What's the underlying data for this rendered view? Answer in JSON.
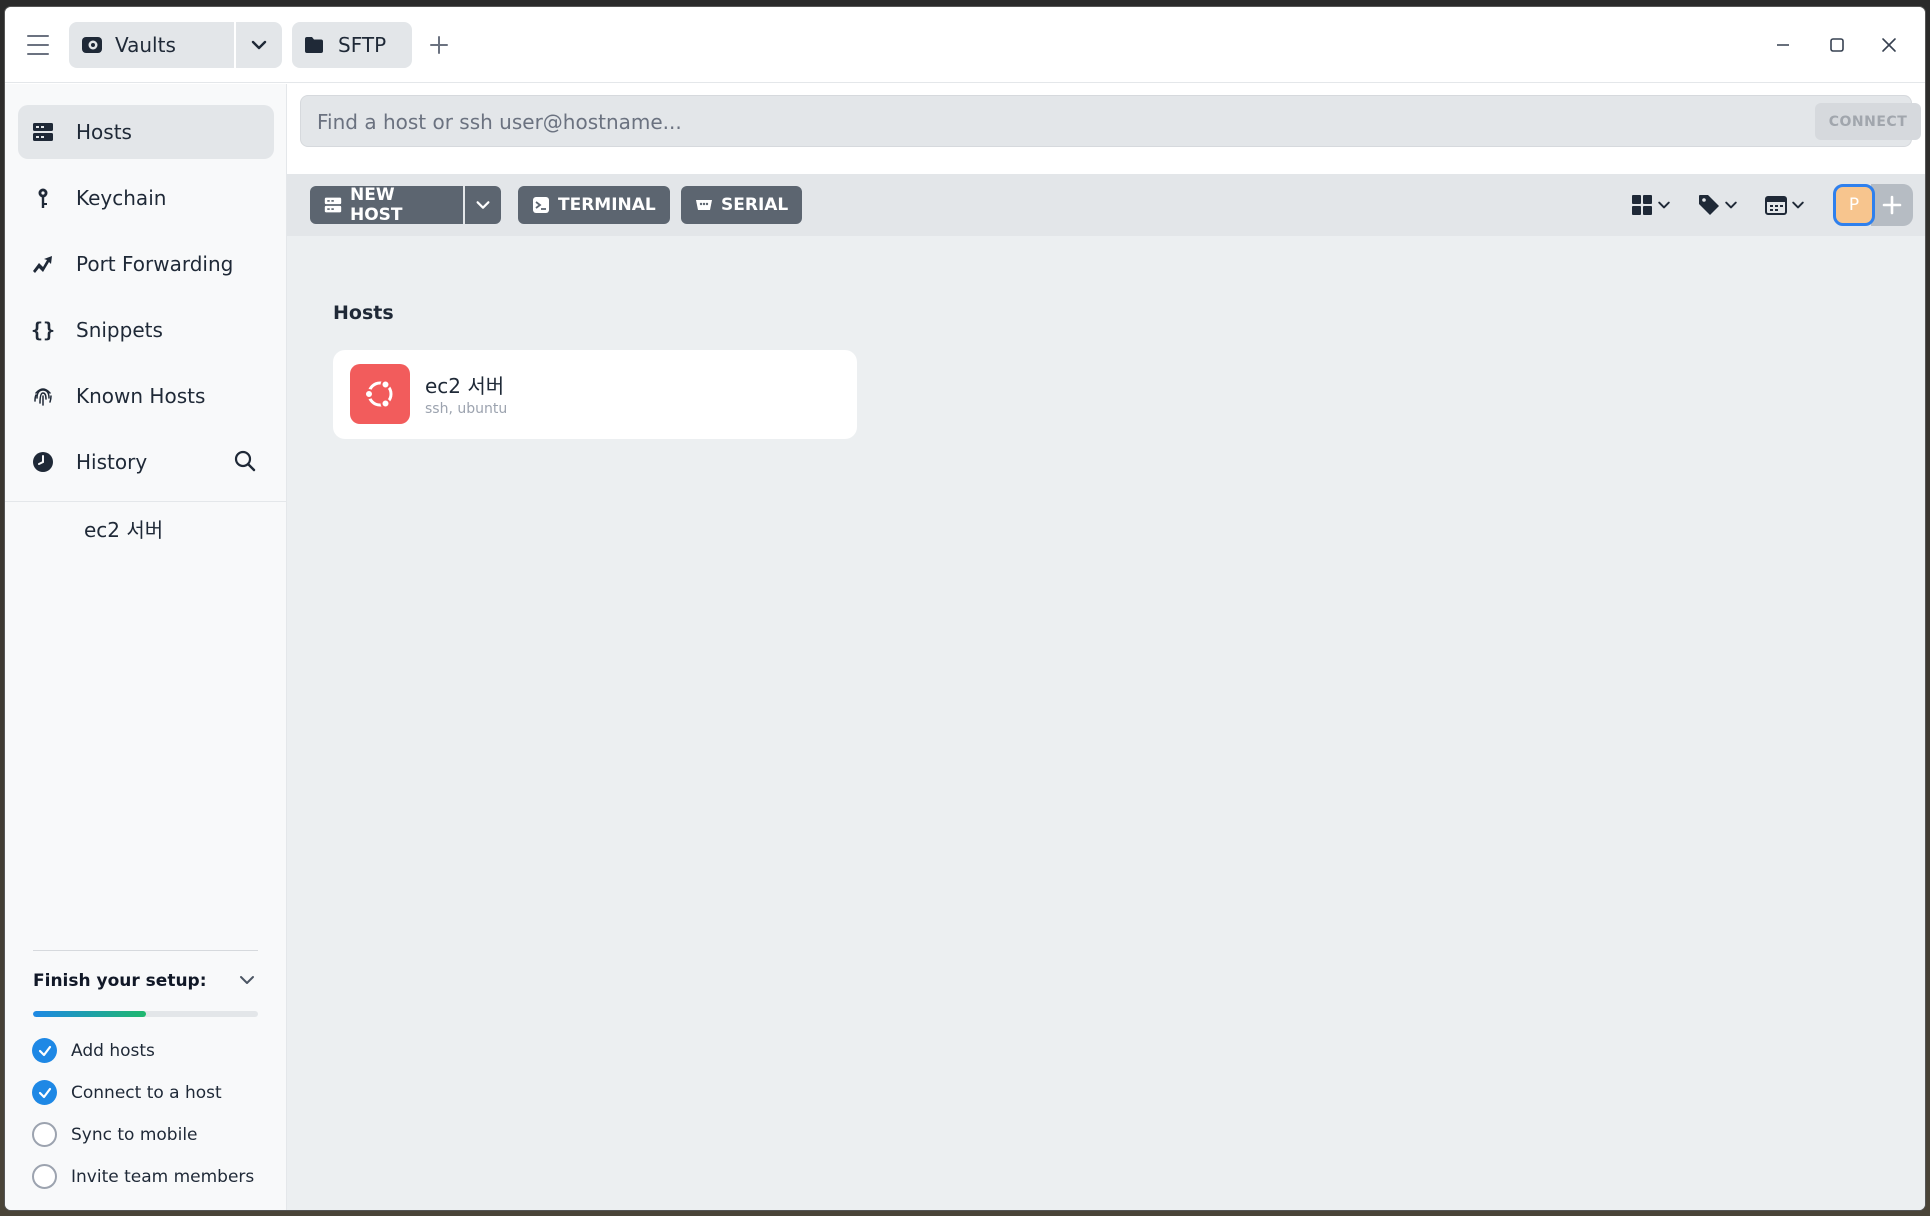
{
  "titlebar": {
    "vault_label": "Vaults",
    "sftp_label": "SFTP",
    "icons": [
      "menu-icon",
      "vault-icon",
      "chevron-down-icon",
      "folder-icon",
      "plus-icon",
      "minimize-icon",
      "maximize-icon",
      "close-icon"
    ]
  },
  "sidebar": {
    "items": [
      {
        "label": "Hosts",
        "icon": "server-icon",
        "active": true
      },
      {
        "label": "Keychain",
        "icon": "key-icon"
      },
      {
        "label": "Port Forwarding",
        "icon": "forward-icon"
      },
      {
        "label": "Snippets",
        "icon": "braces-icon"
      },
      {
        "label": "Known Hosts",
        "icon": "fingerprint-icon"
      },
      {
        "label": "History",
        "icon": "clock-icon"
      }
    ],
    "history_entries": [
      "ec2 서버"
    ],
    "setup": {
      "title": "Finish your setup:",
      "progress_fraction": 0.5,
      "tasks": [
        {
          "label": "Add hosts",
          "done": true
        },
        {
          "label": "Connect to a host",
          "done": true
        },
        {
          "label": "Sync to mobile",
          "done": false
        },
        {
          "label": "Invite team members",
          "done": false
        }
      ]
    }
  },
  "search": {
    "placeholder": "Find a host or ssh user@hostname...",
    "value": "",
    "connect_label": "CONNECT"
  },
  "toolbar": {
    "new_host_label": "NEW HOST",
    "terminal_label": "TERMINAL",
    "serial_label": "SERIAL",
    "avatar_initial": "P"
  },
  "main": {
    "section_title": "Hosts",
    "hosts": [
      {
        "name": "ec2 서버",
        "subtitle": "ssh, ubuntu",
        "os": "ubuntu"
      }
    ]
  },
  "colors": {
    "accent": "#1e88e5",
    "progress_end": "#1fb86e",
    "ubuntu": "#f25c5c",
    "toolbar_button": "#5c6570",
    "avatar": "#f7c58e"
  }
}
